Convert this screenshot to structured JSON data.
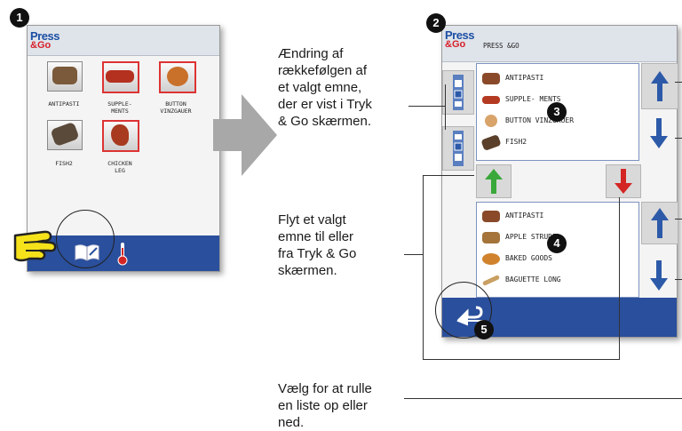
{
  "step_badges": [
    "1",
    "2",
    "3",
    "4",
    "5"
  ],
  "screen1": {
    "logo_line1": "Press",
    "logo_line2": "&Go",
    "tiles": [
      {
        "label": "ANTIPASTI",
        "color": "#7a5a3a"
      },
      {
        "label": "SUPPLE-\nMENTS",
        "color": "#b4301f"
      },
      {
        "label": "BUTTON\nVINZGAUER",
        "color": "#c9702a"
      },
      {
        "label": "FISH2",
        "color": "#5a4a3a"
      },
      {
        "label": "CHICKEN\nLEG",
        "color": "#a83a1f"
      }
    ],
    "footer_icons": [
      "pointing-hand-icon",
      "book-icon",
      "thermometer-icon"
    ]
  },
  "screen2": {
    "logo_line1": "Press",
    "logo_line2": "&Go",
    "title": "PRESS &GO",
    "upper_list": [
      {
        "label": "ANTIPASTI",
        "icon_color": "#8a4a2a"
      },
      {
        "label": "SUPPLE- MENTS",
        "icon_color": "#b43a22"
      },
      {
        "label": "BUTTON VINZGAUER",
        "icon_color": "#d9a46a"
      },
      {
        "label": "FISH2",
        "icon_color": "#5a3f2a"
      }
    ],
    "lower_list": [
      {
        "label": "ANTIPASTI",
        "icon_color": "#8a4a2a"
      },
      {
        "label": "APPLE STRUDEL",
        "icon_color": "#a4743a"
      },
      {
        "label": "BAKED GOODS",
        "icon_color": "#d0832c"
      },
      {
        "label": "BAGUETTE LONG",
        "icon_color": "#c9a063"
      }
    ],
    "colors": {
      "up_arrow": "#2d5aa8",
      "move_in": "#3aa83a",
      "move_out": "#d42525",
      "footer": "#2a4f9c"
    }
  },
  "captions": {
    "reorder": "Ændring af\nrækkefølgen af\net valgt emne,\nder er vist i Tryk\n& Go skærmen.",
    "move": "Flyt et valgt\nemne til eller\nfra Tryk & Go\nskærmen.",
    "scroll": "Vælg for at rulle\nen liste op eller\nned."
  }
}
